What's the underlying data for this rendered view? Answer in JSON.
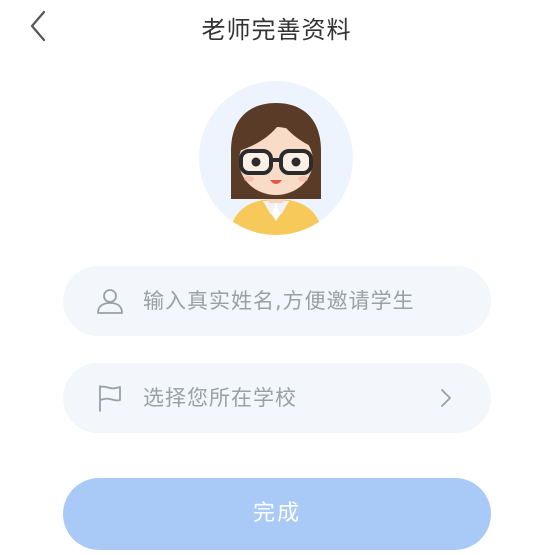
{
  "header": {
    "title": "老师完善资料",
    "back_icon": "chevron-left-icon"
  },
  "avatar": {
    "description_icon": "teacher-avatar-icon"
  },
  "name_field": {
    "icon": "user-icon",
    "placeholder": "输入真实姓名,方便邀请学生"
  },
  "school_field": {
    "icon": "flag-icon",
    "label": "选择您所在学校",
    "chevron_icon": "chevron-right-icon"
  },
  "submit": {
    "label": "完成"
  },
  "colors": {
    "accent_disabled": "#a9c9f7",
    "field_bg": "#f3f6fa",
    "avatar_bg": "#eef4fd",
    "placeholder": "#9aa0a8",
    "title": "#333333"
  }
}
